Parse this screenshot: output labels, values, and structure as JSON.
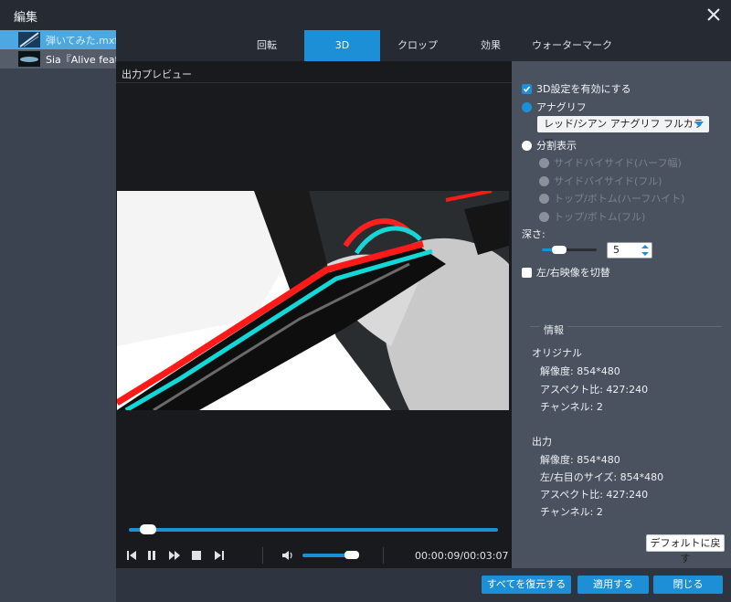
{
  "window": {
    "title": "編集"
  },
  "files": [
    {
      "name": "弾いてみた.mxf"
    },
    {
      "name": "Sia『Alive feat..."
    }
  ],
  "tabs": [
    {
      "label": "回転"
    },
    {
      "label": "3D"
    },
    {
      "label": "クロップ"
    },
    {
      "label": "効果"
    },
    {
      "label": "ウォーターマーク"
    }
  ],
  "preview": {
    "label": "出力プレビュー",
    "time": "00:00:09/00:03:07",
    "progress": 0.04,
    "volume": 0.85
  },
  "settings": {
    "enable_3d": "3D設定を有効にする",
    "anaglyph": "アナグリフ",
    "anaglyph_option": "レッド/シアン アナグリフ フルカラー",
    "split": "分割表示",
    "split_options": [
      "サイドバイサイド(ハーフ幅)",
      "サイドバイサイド(フル)",
      "トップ/ボトム(ハーフハイト)",
      "トップ/ボトム(フル)"
    ],
    "depth_label": "深さ:",
    "depth_value": "5",
    "swap": "左/右映像を切替"
  },
  "info": {
    "title": "情報",
    "original": {
      "heading": "オリジナル",
      "resolution": "解像度: 854*480",
      "aspect": "アスペクト比: 427:240",
      "channels": "チャンネル: 2"
    },
    "output": {
      "heading": "出力",
      "resolution": "解像度: 854*480",
      "eye_size": "左/右目のサイズ: 854*480",
      "aspect": "アスペクト比: 427:240",
      "channels": "チャンネル: 2"
    }
  },
  "buttons": {
    "reset_default": "デフォルトに戻す",
    "restore_all": "すべてを復元する",
    "apply": "適用する",
    "close": "閉じる"
  },
  "colors": {
    "accent": "#1c8fd6",
    "file_selected": "#4da8df"
  }
}
